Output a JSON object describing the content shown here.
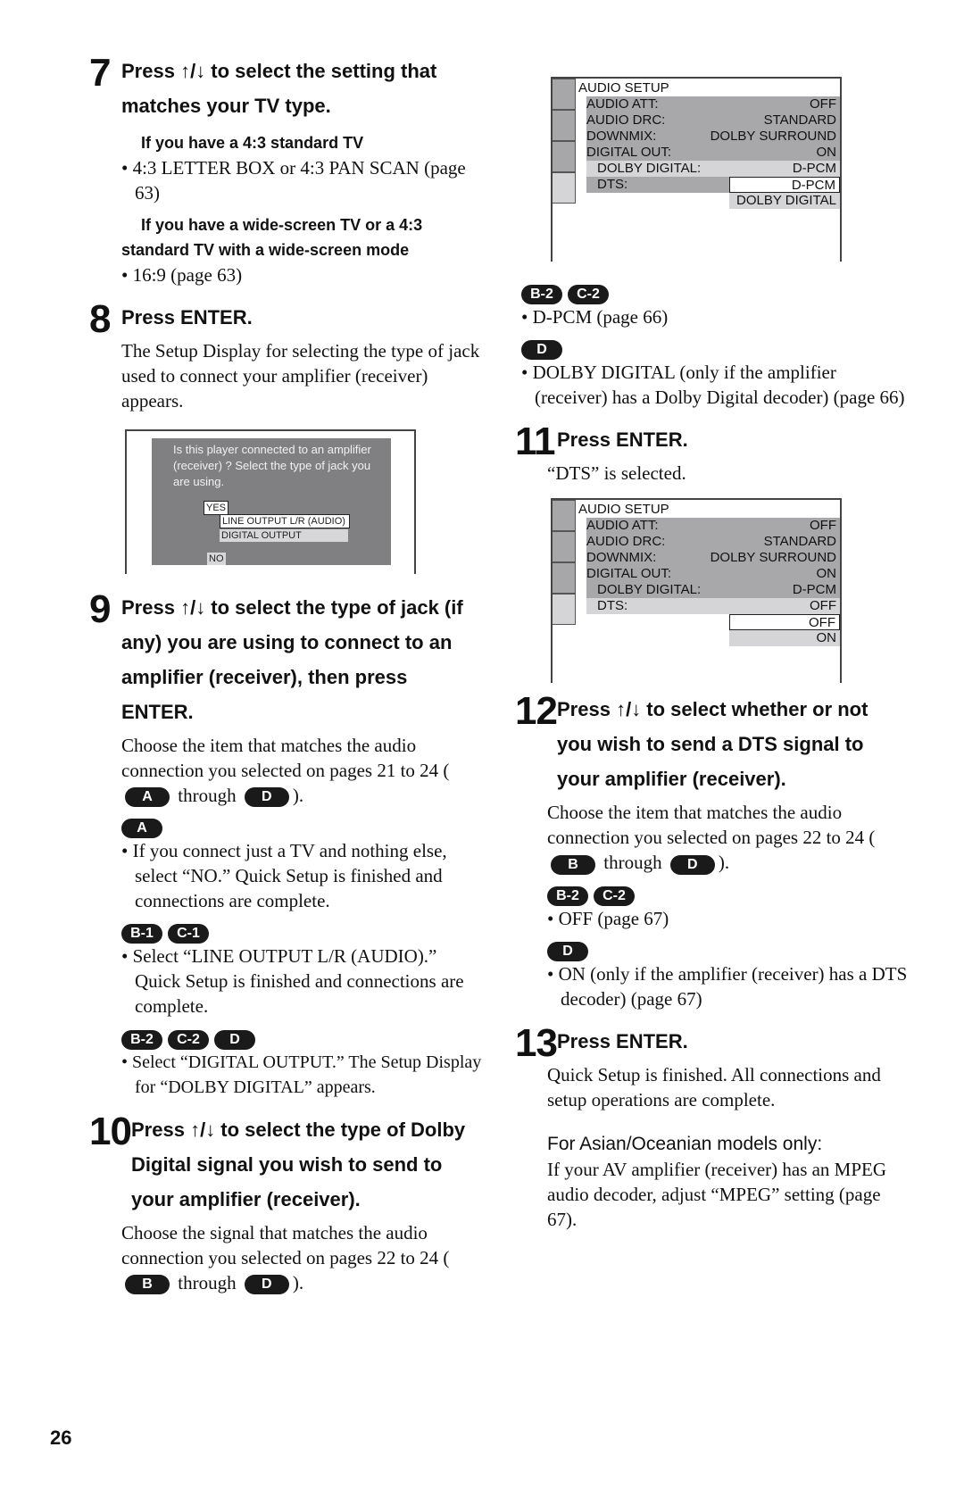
{
  "page_number": "26",
  "icons": {
    "up_arrow": "↑",
    "down_arrow": "↓"
  },
  "step7": {
    "num": "7",
    "head_pre": "Press ",
    "head_post": " to select the setting that matches your TV type.",
    "case1_head": "If you have a 4:3 standard TV",
    "case1_bullet": "• 4:3 LETTER BOX or 4:3 PAN SCAN (page 63)",
    "case2_head": "If you have a wide-screen TV or a 4:3 standard TV with a wide-screen mode",
    "case2_bullet": "• 16:9 (page 63)"
  },
  "step8": {
    "num": "8",
    "head": "Press ENTER.",
    "body": "The Setup Display for selecting the type of jack used to connect your amplifier (receiver) appears.",
    "osd": {
      "message": "Is this player connected to an amplifier (receiver) ? Select the type of jack you are using.",
      "yes": "YES",
      "line_output": "LINE OUTPUT L/R (AUDIO)",
      "digital_output": "DIGITAL OUTPUT",
      "no": "NO"
    }
  },
  "step9": {
    "num": "9",
    "head_pre": "Press ",
    "head_post": " to select the type of jack (if any) you are using to connect to an amplifier (receiver), then press ENTER.",
    "body_pre": "Choose the item that matches the audio connection you selected on pages 21 to 24 (",
    "badge_from": "A",
    "body_mid": " through ",
    "badge_to": "D",
    "body_post": ").",
    "options": [
      {
        "badges": [
          "A"
        ],
        "text": "• If you connect just a TV and nothing else, select “NO.” Quick Setup is finished and connections are complete."
      },
      {
        "badges": [
          "B-1",
          "C-1"
        ],
        "text": "• Select “LINE OUTPUT L/R (AUDIO).” Quick Setup is finished and connections are complete."
      },
      {
        "badges": [
          "B-2",
          "C-2",
          "D"
        ],
        "text": "• Select “DIGITAL OUTPUT.” The Setup Display for “DOLBY DIGITAL” appears."
      }
    ]
  },
  "step10": {
    "num": "10",
    "head_pre": "Press ",
    "head_post": " to select the type of Dolby Digital signal you wish to send to your amplifier (receiver).",
    "body_pre": "Choose the signal that matches the audio connection you selected on pages 22 to 24 (",
    "badge_from": "B",
    "body_mid": " through ",
    "badge_to": "D",
    "body_post": ")."
  },
  "audio_setup_1": {
    "title": "AUDIO SETUP",
    "rows": [
      {
        "label": "AUDIO ATT:",
        "value": "OFF"
      },
      {
        "label": "AUDIO DRC:",
        "value": "STANDARD"
      },
      {
        "label": "DOWNMIX:",
        "value": "DOLBY SURROUND"
      },
      {
        "label": "DIGITAL OUT:",
        "value": "ON"
      },
      {
        "label": "DOLBY DIGITAL:",
        "value": "D-PCM"
      },
      {
        "label": "DTS:",
        "value": ""
      }
    ],
    "popup": [
      "D-PCM",
      "DOLBY DIGITAL"
    ]
  },
  "step10_options": [
    {
      "badges": [
        "B-2",
        "C-2"
      ],
      "text": "• D-PCM (page 66)"
    },
    {
      "badges": [
        "D"
      ],
      "text": "• DOLBY DIGITAL (only if the amplifier (receiver) has a Dolby Digital decoder) (page 66)"
    }
  ],
  "step11": {
    "num": "11",
    "head": "Press ENTER.",
    "body": "“DTS” is selected."
  },
  "audio_setup_2": {
    "title": "AUDIO SETUP",
    "rows": [
      {
        "label": "AUDIO ATT:",
        "value": "OFF"
      },
      {
        "label": "AUDIO DRC:",
        "value": "STANDARD"
      },
      {
        "label": "DOWNMIX:",
        "value": "DOLBY SURROUND"
      },
      {
        "label": "DIGITAL OUT:",
        "value": "ON"
      },
      {
        "label": "DOLBY DIGITAL:",
        "value": "D-PCM"
      },
      {
        "label": "DTS:",
        "value": "OFF"
      }
    ],
    "popup": [
      "OFF",
      "ON"
    ]
  },
  "step12": {
    "num": "12",
    "head_pre": "Press ",
    "head_post": " to select whether or not you wish to send a DTS signal to your amplifier (receiver).",
    "body_pre": "Choose the item that matches the audio connection you selected on pages 22 to 24 (",
    "badge_from": "B",
    "body_mid": " through ",
    "badge_to": "D",
    "body_post": ").",
    "options": [
      {
        "badges": [
          "B-2",
          "C-2"
        ],
        "text": "• OFF (page 67)"
      },
      {
        "badges": [
          "D"
        ],
        "text": "• ON (only if the amplifier (receiver) has a DTS decoder) (page 67)"
      }
    ]
  },
  "step13": {
    "num": "13",
    "head": "Press ENTER.",
    "body": "Quick Setup is finished. All connections and setup operations are complete.",
    "note_head": "For Asian/Oceanian models only:",
    "note_body": "If your AV amplifier (receiver) has an MPEG audio decoder, adjust “MPEG” setting (page 67)."
  }
}
